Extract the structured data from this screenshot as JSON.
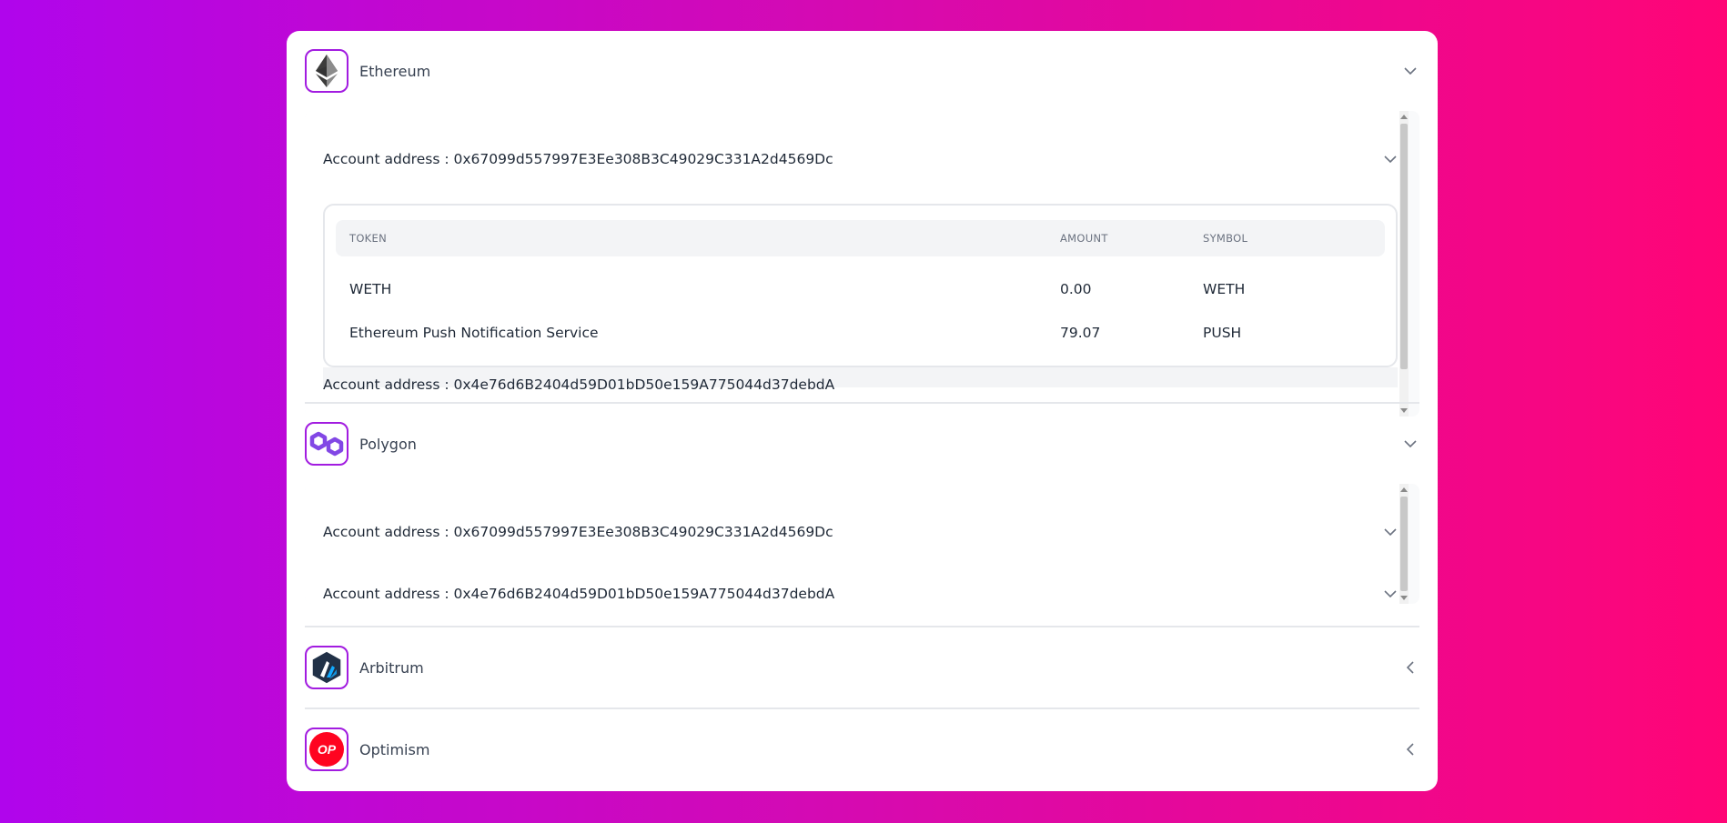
{
  "chains": [
    {
      "name": "Ethereum",
      "logo_icon": "ethereum-icon",
      "state": "expanded",
      "accounts": [
        {
          "label": "Account address : 0x67099d557997E3Ee308B3C49029C331A2d4569Dc",
          "state": "expanded",
          "table": {
            "headers": [
              "TOKEN",
              "AMOUNT",
              "SYMBOL"
            ],
            "rows": [
              {
                "token": "WETH",
                "amount": "0.00",
                "symbol": "WETH"
              },
              {
                "token": "Ethereum Push Notification Service",
                "amount": "79.07",
                "symbol": "PUSH"
              }
            ]
          }
        },
        {
          "label": "Account address : 0x4e76d6B2404d59D01bD50e159A775044d37debdA",
          "state": "collapsed"
        }
      ]
    },
    {
      "name": "Polygon",
      "logo_icon": "polygon-icon",
      "state": "expanded",
      "accounts": [
        {
          "label": "Account address : 0x67099d557997E3Ee308B3C49029C331A2d4569Dc",
          "state": "collapsed"
        },
        {
          "label": "Account address : 0x4e76d6B2404d59D01bD50e159A775044d37debdA",
          "state": "collapsed"
        }
      ]
    },
    {
      "name": "Arbitrum",
      "logo_icon": "arbitrum-icon",
      "state": "collapsed"
    },
    {
      "name": "Optimism",
      "logo_icon": "optimism-icon",
      "logo_text": "OP",
      "state": "collapsed"
    }
  ],
  "colors": {
    "gradient_start": "#b005ec",
    "gradient_end": "#ff0576",
    "logo_border": "#a21ce0",
    "optimism_red": "#ff0420"
  }
}
